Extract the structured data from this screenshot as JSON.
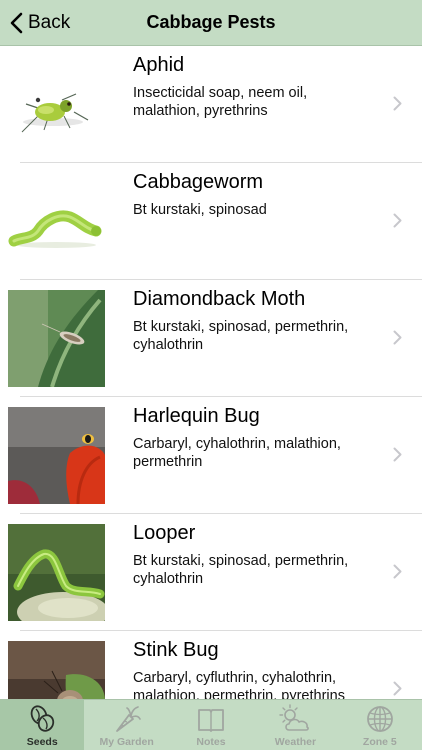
{
  "nav": {
    "back_label": "Back",
    "title": "Cabbage Pests"
  },
  "pests": [
    {
      "name": "Aphid",
      "treatment": "Insecticidal soap, neem oil, malathion, pyrethrins",
      "image": "aphid-photo"
    },
    {
      "name": "Cabbageworm",
      "treatment": "Bt kurstaki, spinosad",
      "image": "cabbageworm-photo"
    },
    {
      "name": "Diamondback Moth",
      "treatment": "Bt kurstaki, spinosad, permethrin, cyhalothrin",
      "image": "diamondback-moth-photo"
    },
    {
      "name": "Harlequin Bug",
      "treatment": "Carbaryl, cyhalothrin, malathion, permethrin",
      "image": "harlequin-bug-photo"
    },
    {
      "name": "Looper",
      "treatment": "Bt kurstaki, spinosad, permethrin, cyhalothrin",
      "image": "looper-photo"
    },
    {
      "name": "Stink Bug",
      "treatment": "Carbaryl, cyfluthrin, cyhalothrin, malathion, permethrin, pyrethrins",
      "image": "stink-bug-photo"
    }
  ],
  "tabs": [
    {
      "label": "Seeds",
      "icon": "seeds-icon",
      "active": true
    },
    {
      "label": "My Garden",
      "icon": "carrot-icon",
      "active": false
    },
    {
      "label": "Notes",
      "icon": "notebook-icon",
      "active": false
    },
    {
      "label": "Weather",
      "icon": "sun-cloud-icon",
      "active": false
    },
    {
      "label": "Zone 5",
      "icon": "globe-icon",
      "active": false
    }
  ],
  "colors": {
    "bar_background": "#c4dcc4",
    "active_tab": "#a7c7a7",
    "inactive_tab_text": "#a0a6a0"
  }
}
